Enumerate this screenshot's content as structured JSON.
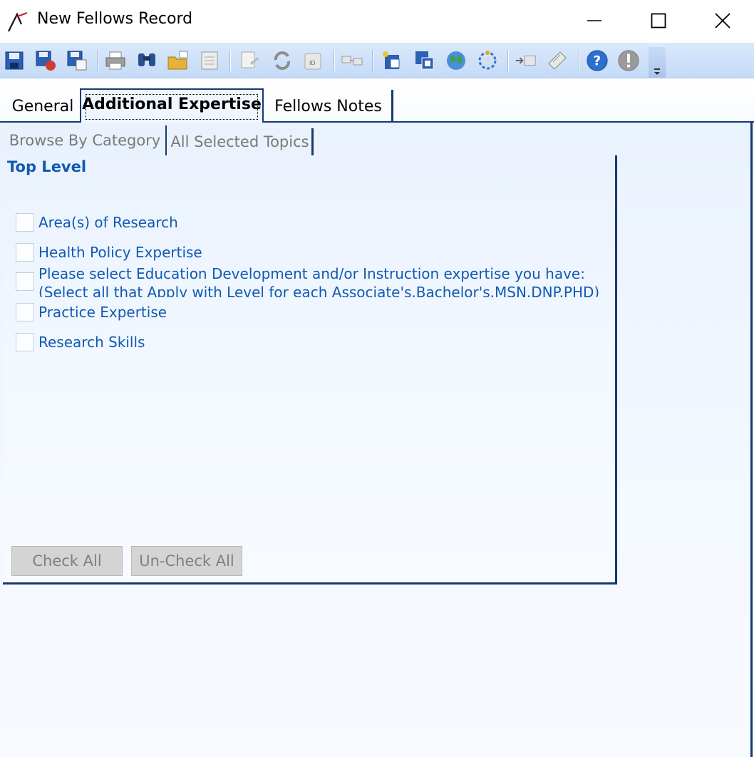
{
  "window": {
    "title": "New Fellows Record",
    "controls": [
      "minimize-icon",
      "maximize-icon",
      "close-icon"
    ]
  },
  "toolbar": {
    "icons": [
      "save-icon",
      "save-and-close-icon",
      "save-and-new-icon",
      "print-icon",
      "find-icon",
      "open-folder-icon",
      "properties-icon",
      "notes-icon",
      "refresh-icon",
      "id-card-icon",
      "link-icon",
      "new-record-icon",
      "duplicate-icon",
      "web-icon",
      "process-icon",
      "import-icon",
      "edit-icon",
      "help-icon",
      "warning-icon",
      "overflow-chevron-icon"
    ],
    "accent_color": "#c4daf7"
  },
  "tabs": {
    "general": "General",
    "additional": "Additional Expertise",
    "notes": "Fellows Notes",
    "active": "Additional Expertise"
  },
  "subtabs": {
    "browse": "Browse By Category",
    "all": "All Selected Topics",
    "active": "Browse By Category"
  },
  "panel": {
    "heading": "Top Level",
    "items": [
      {
        "label": "Area(s) of Research",
        "checked": false
      },
      {
        "label": "Health Policy Expertise",
        "checked": false
      },
      {
        "label": "Please select Education Development and/or Instruction expertise you have:",
        "label2": "(Select all that Apply with Level for each Associate's.Bachelor's.MSN.DNP.PHD)",
        "checked": false
      },
      {
        "label": "Practice Expertise",
        "checked": false
      },
      {
        "label": "Research Skills",
        "checked": false
      }
    ],
    "check_all": "Check All",
    "uncheck_all": "Un-Check All"
  },
  "colors": {
    "link_blue": "#1059b4",
    "tab_border": "#153a6e"
  }
}
